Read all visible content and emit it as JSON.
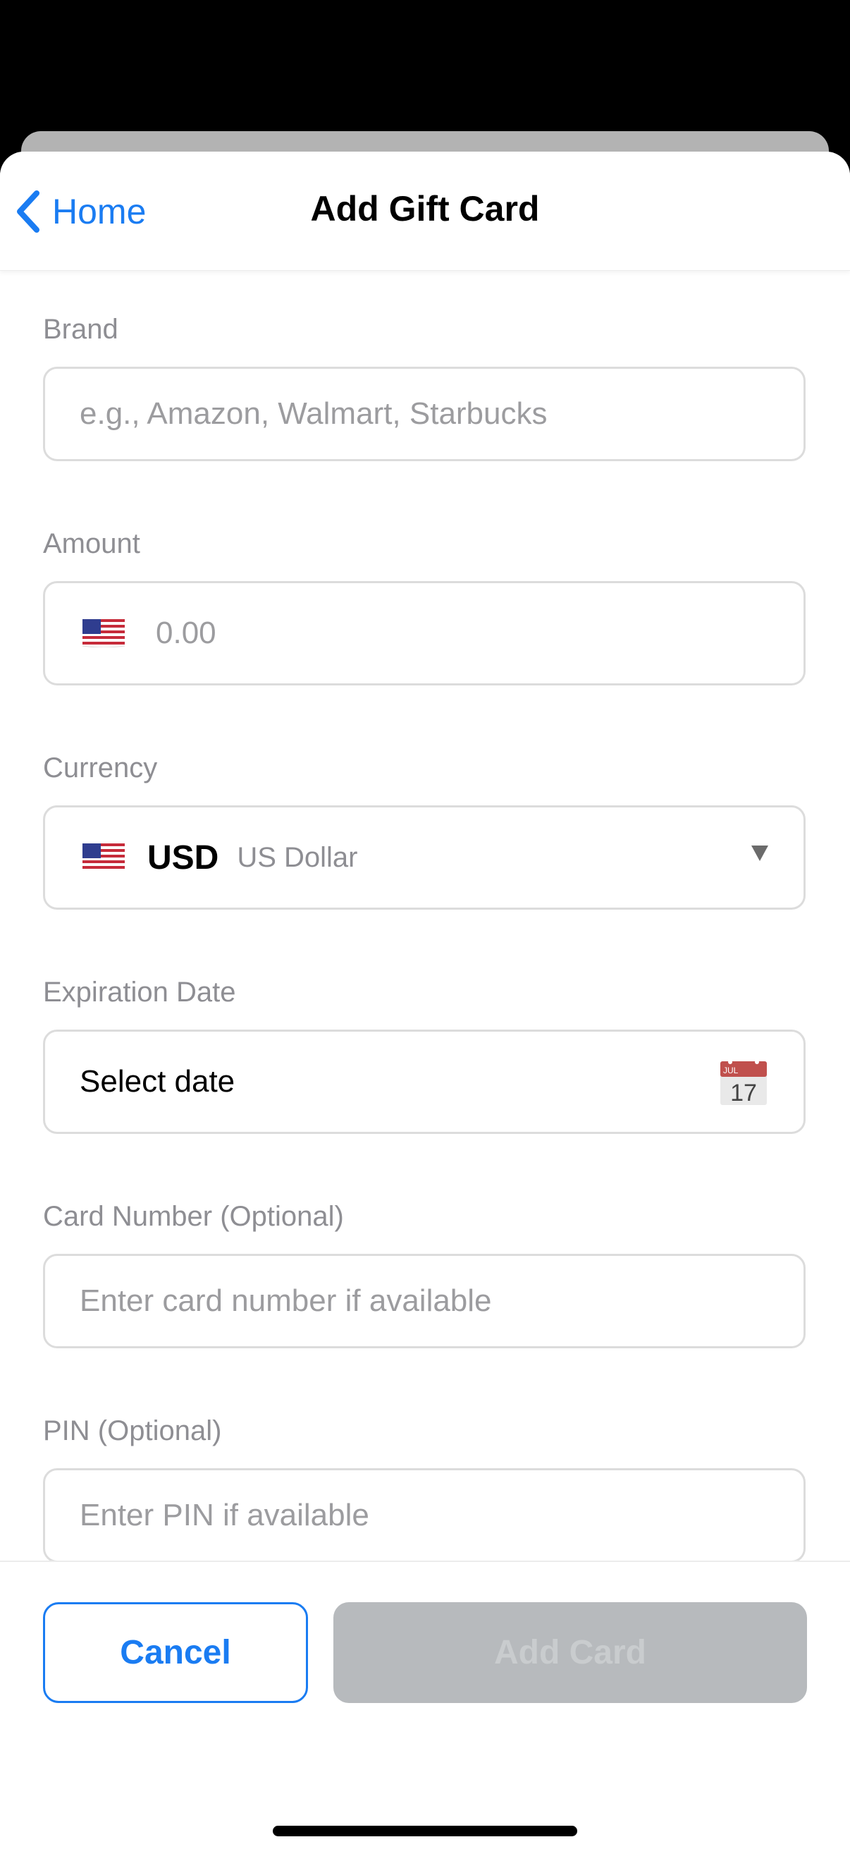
{
  "nav": {
    "back_label": "Home",
    "title": "Add Gift Card"
  },
  "form": {
    "brand": {
      "label": "Brand",
      "placeholder": "e.g., Amazon, Walmart, Starbucks"
    },
    "amount": {
      "label": "Amount",
      "flag": "us-flag-icon",
      "placeholder": "0.00"
    },
    "currency": {
      "label": "Currency",
      "flag": "us-flag-icon",
      "code": "USD",
      "name": "US Dollar"
    },
    "expiration": {
      "label": "Expiration Date",
      "value": "Select date",
      "calendar_month": "JUL",
      "calendar_day": "17"
    },
    "card_number": {
      "label": "Card Number (Optional)",
      "placeholder": "Enter card number if available"
    },
    "pin": {
      "label": "PIN (Optional)",
      "placeholder": "Enter PIN if available"
    }
  },
  "footer": {
    "cancel_label": "Cancel",
    "add_label": "Add Card"
  },
  "colors": {
    "accent": "#1a7cf2",
    "disabled_button": "#b7babd",
    "label_gray": "#8e8e93"
  }
}
